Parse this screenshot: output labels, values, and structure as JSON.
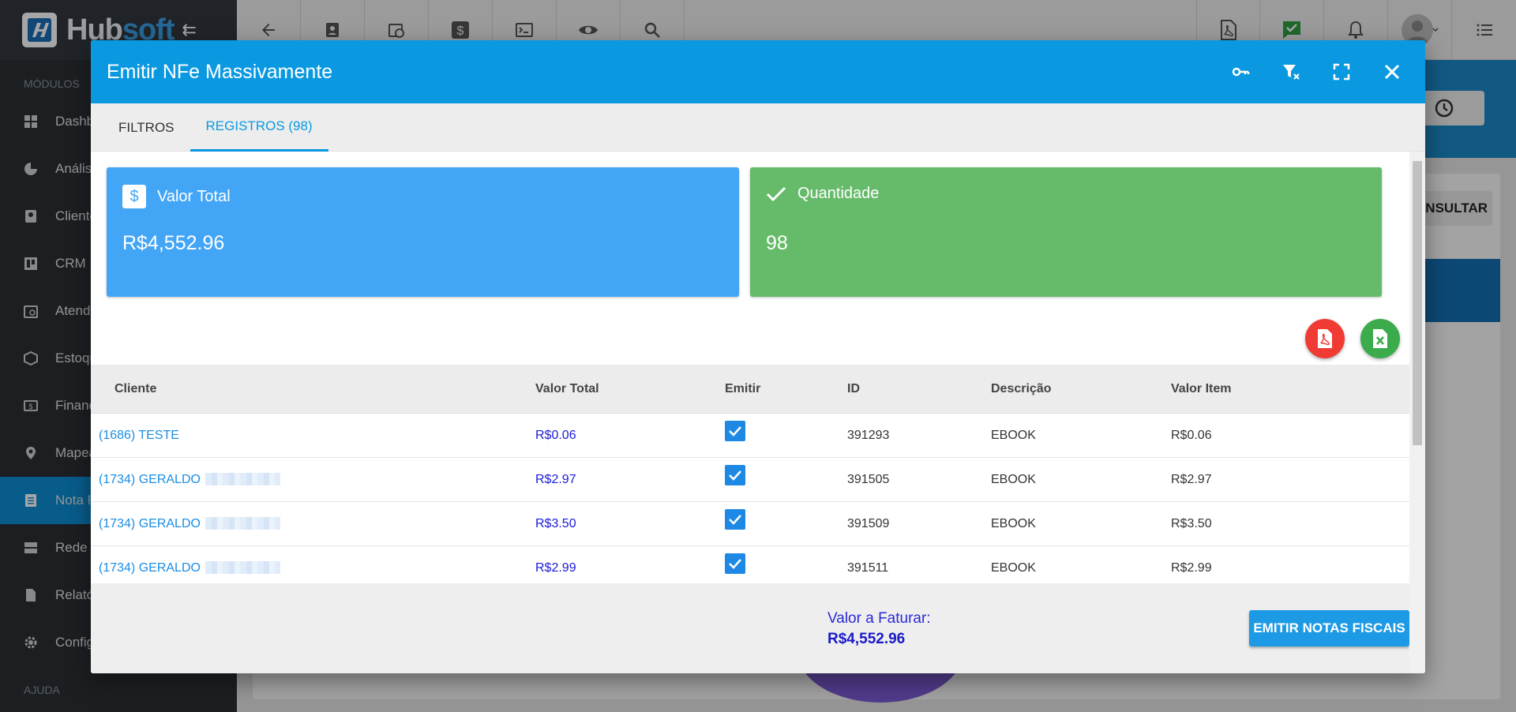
{
  "app": {
    "logo_prefix": "Hub",
    "logo_suffix": "soft"
  },
  "sidebar": {
    "section_modules": "MÓDULOS",
    "section_help": "AJUDA",
    "items": [
      {
        "label": "Dashb",
        "icon": "dashboard-icon"
      },
      {
        "label": "Anális",
        "icon": "pie-chart-icon"
      },
      {
        "label": "Cliente",
        "icon": "contact-icon"
      },
      {
        "label": "CRM",
        "icon": "board-icon"
      },
      {
        "label": "Atendi",
        "icon": "calendar-clock-icon"
      },
      {
        "label": "Estoqu",
        "icon": "box-icon"
      },
      {
        "label": "Financ",
        "icon": "money-icon"
      },
      {
        "label": "Mapea",
        "icon": "map-pin-icon"
      },
      {
        "label": "Nota F",
        "icon": "document-icon"
      },
      {
        "label": "Rede",
        "icon": "server-icon"
      },
      {
        "label": "Relató",
        "icon": "report-icon"
      },
      {
        "label": "Config",
        "icon": "gear-icon"
      }
    ]
  },
  "background": {
    "consult_label": "ONSULTAR"
  },
  "modal": {
    "title": "Emitir NFe Massivamente",
    "tabs": [
      {
        "label": "FILTROS"
      },
      {
        "label": "REGISTROS (98)"
      }
    ],
    "stats": {
      "total_label": "Valor Total",
      "total_value": "R$4,552.96",
      "qty_label": "Quantidade",
      "qty_value": "98"
    },
    "table": {
      "headers": [
        "Cliente",
        "Valor Total",
        "Emitir",
        "ID",
        "Descrição",
        "Valor Item"
      ],
      "rows": [
        {
          "cliente": "(1686) TESTE",
          "valor_total": "R$0.06",
          "emitir": true,
          "id": "391293",
          "descricao": "EBOOK",
          "valor_item": "R$0.06"
        },
        {
          "cliente": "(1734) GERALDO",
          "valor_total": "R$2.97",
          "emitir": true,
          "id": "391505",
          "descricao": "EBOOK",
          "valor_item": "R$2.97"
        },
        {
          "cliente": "(1734) GERALDO",
          "valor_total": "R$3.50",
          "emitir": true,
          "id": "391509",
          "descricao": "EBOOK",
          "valor_item": "R$3.50"
        },
        {
          "cliente": "(1734) GERALDO",
          "valor_total": "R$2.99",
          "emitir": true,
          "id": "391511",
          "descricao": "EBOOK",
          "valor_item": "R$2.99"
        }
      ]
    },
    "footer": {
      "label": "Valor a Faturar:",
      "value": "R$4,552.96",
      "button": "EMITIR NOTAS FISCAIS"
    }
  }
}
